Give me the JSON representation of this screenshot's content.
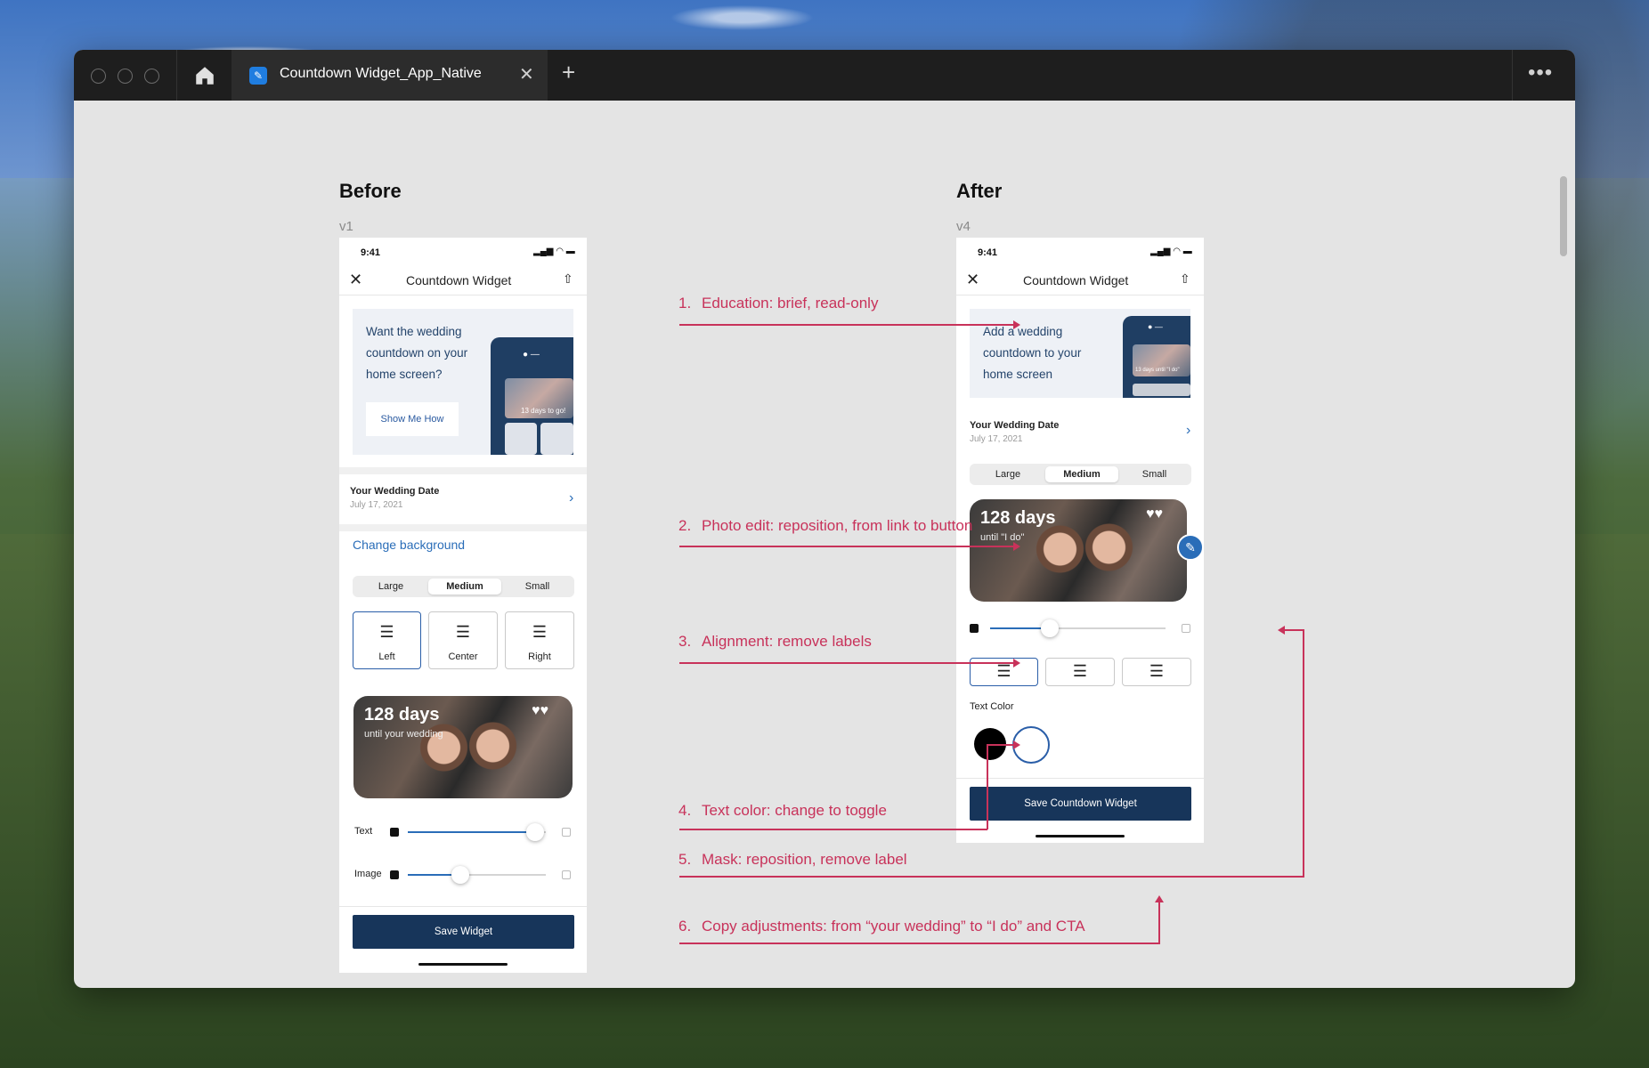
{
  "window": {
    "tab_title": "Countdown Widget_App_Native",
    "tab_close": "✕",
    "tab_add": "+",
    "more": "•••"
  },
  "before": {
    "heading": "Before",
    "version": "v1",
    "time": "9:41",
    "nav_title": "Countdown Widget",
    "edu_text_1": "Want the wedding",
    "edu_text_2": "countdown on your",
    "edu_text_3": "home screen?",
    "edu_button": "Show Me How",
    "mini_caption": "13 days to go!",
    "date_title": "Your Wedding Date",
    "date_value": "July 17, 2021",
    "change_bg": "Change background",
    "sizes": [
      "Large",
      "Medium",
      "Small"
    ],
    "selected_size": "Medium",
    "align": [
      "Left",
      "Center",
      "Right"
    ],
    "selected_align": "Left",
    "widget_days": "128 days",
    "widget_sub": "until your wedding",
    "text_label": "Text",
    "image_label": "Image",
    "text_slider": 0.92,
    "image_slider": 0.38,
    "cta": "Save Widget"
  },
  "after": {
    "heading": "After",
    "version": "v4",
    "time": "9:41",
    "nav_title": "Countdown Widget",
    "edu_text_1": "Add a wedding",
    "edu_text_2": "countdown to your",
    "edu_text_3": "home screen",
    "mini_caption": "13 days until \"I do\"",
    "date_title": "Your Wedding Date",
    "date_value": "July 17, 2021",
    "sizes": [
      "Large",
      "Medium",
      "Small"
    ],
    "selected_size": "Medium",
    "widget_days": "128 days",
    "widget_sub": "until \"I do\"",
    "mask_slider": 0.34,
    "text_color_label": "Text Color",
    "selected_color": "#ffffff",
    "colors": [
      "#000000",
      "#ffffff"
    ],
    "cta": "Save Countdown Widget"
  },
  "notes": [
    {
      "num": "1.",
      "text": "Education: brief, read-only"
    },
    {
      "num": "2.",
      "text": "Photo edit: reposition, from link to button"
    },
    {
      "num": "3.",
      "text": "Alignment: remove labels"
    },
    {
      "num": "4.",
      "text": "Text color: change to toggle"
    },
    {
      "num": "5.",
      "text": "Mask: reposition, remove label"
    },
    {
      "num": "6.",
      "text": "Copy adjustments: from “your wedding” to “I do” and CTA"
    }
  ],
  "colors": {
    "annotation": "#c8325a",
    "accent": "#2a6db8",
    "cta": "#17355a"
  }
}
